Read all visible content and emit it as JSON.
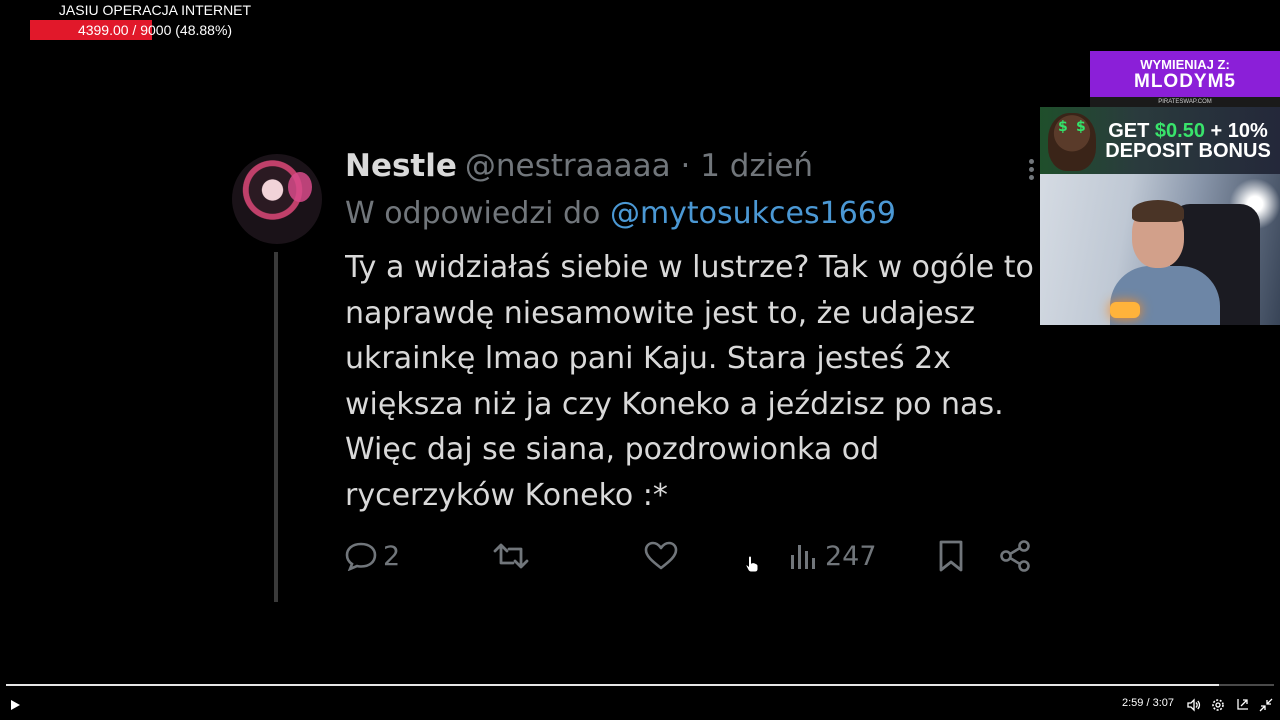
{
  "goal": {
    "title": "JASIU OPERACJA INTERNET",
    "progress_text": "4399.00 / 9000 (48.88%)",
    "progress_fraction": 0.4888,
    "bar_color": "#e1182a"
  },
  "tweet": {
    "author_name": "Nestle",
    "handle_time": "@nestraaaaa · 1 dzień",
    "reply_prefix": "W odpowiedzi do",
    "reply_mention": "@mytosukces1669",
    "body_lines": [
      "Ty a widziałaś siebie w lustrze? Tak w ogóle to",
      "naprawdę niesamowite jest to, że udajesz",
      "ukrainkę lmao pani Kaju. Stara jesteś 2x",
      "większa niż ja czy Koneko a jeździsz po nas.",
      "Więc daj se siana, pozdrowionka od",
      "rycerzyków Koneko :*"
    ],
    "replies_count": "2",
    "views_count": "247",
    "mention_color": "#4b98d4"
  },
  "sponsors": {
    "swap_top": "WYMIENIAJ Z:",
    "swap_code": "MLODYM5",
    "swap_site": "PIRATESWAP.COM",
    "bonus_line1_prefix": "GET ",
    "bonus_line1_amount": "$0.50",
    "bonus_line1_suffix": " + 10%",
    "bonus_line2": "DEPOSIT BONUS"
  },
  "player": {
    "time": "2:59 / 3:07",
    "progress_fraction": 0.957,
    "icons": [
      "play-icon",
      "volume-icon",
      "settings-icon",
      "miniplayer-icon",
      "exit-fullscreen-icon"
    ]
  }
}
